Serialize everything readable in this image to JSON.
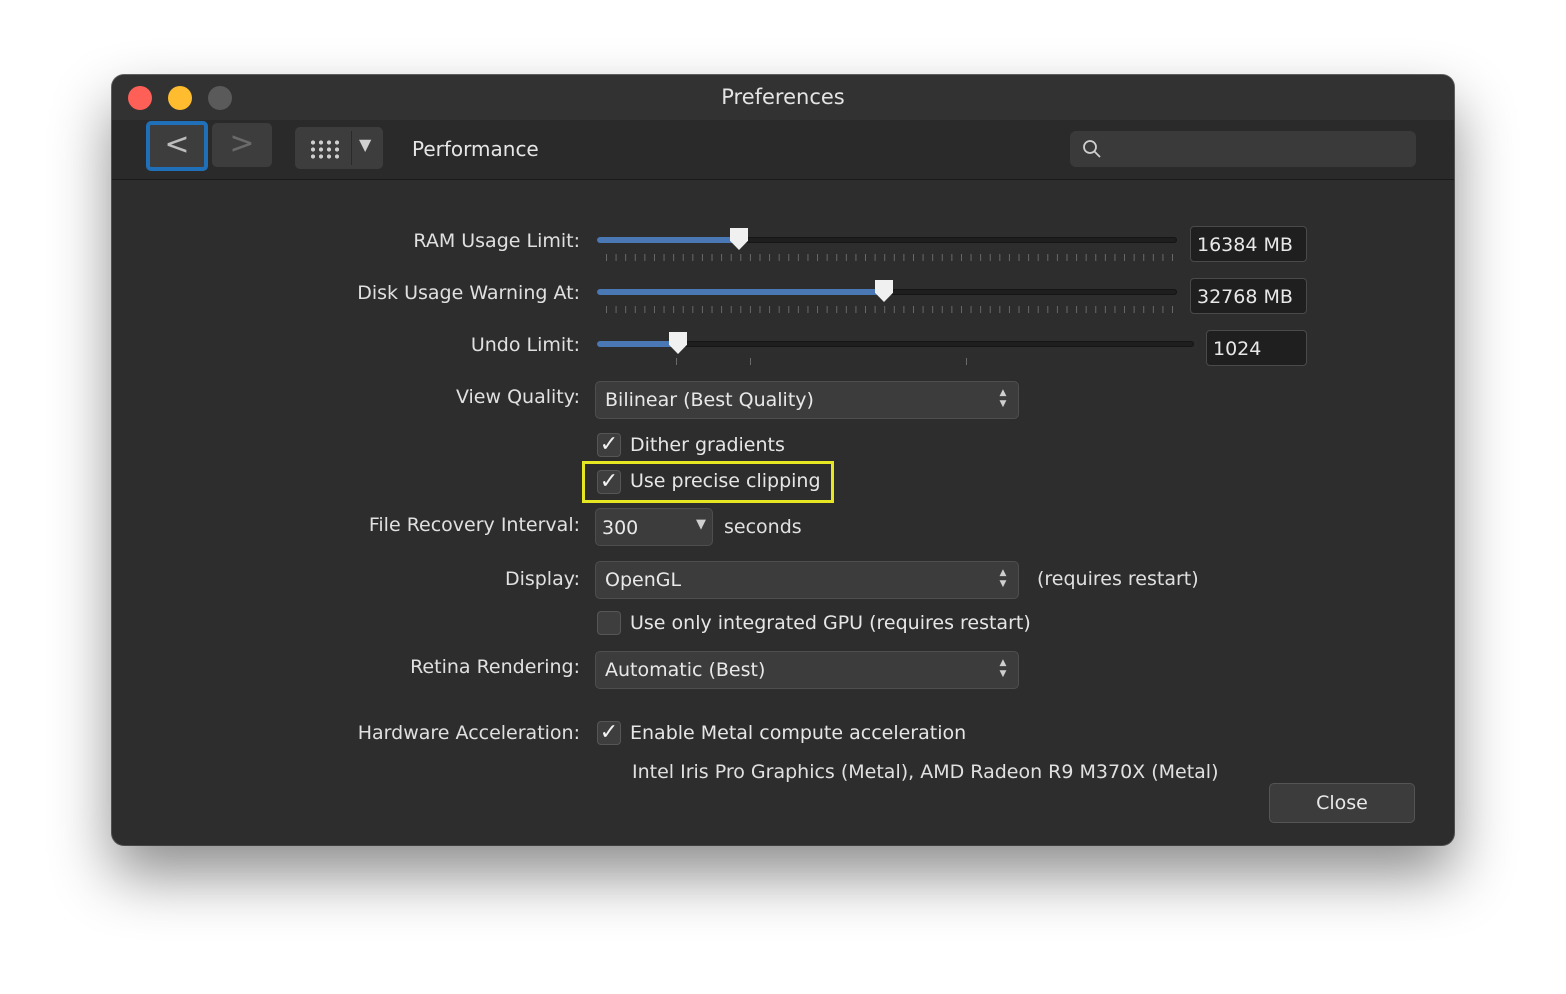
{
  "window": {
    "title": "Preferences"
  },
  "toolbar": {
    "back_symbol": "<",
    "forward_symbol": ">",
    "grid_menu_arrow": "▼",
    "section_title": "Performance",
    "search_placeholder": ""
  },
  "ram": {
    "label": "RAM Usage Limit:",
    "value": "16384 MB",
    "fraction": 0.245
  },
  "disk": {
    "label": "Disk Usage Warning At:",
    "value": "32768 MB",
    "fraction": 0.495
  },
  "undo": {
    "label": "Undo Limit:",
    "value": "1024",
    "fraction": 0.135
  },
  "view_quality": {
    "label": "View Quality:",
    "selected": "Bilinear (Best Quality)"
  },
  "dither": {
    "label": "Dither gradients",
    "checked": true
  },
  "precise_clipping": {
    "label": "Use precise clipping",
    "checked": true
  },
  "file_recovery": {
    "label": "File Recovery Interval:",
    "value": "300",
    "unit": "seconds"
  },
  "display": {
    "label": "Display:",
    "selected": "OpenGL",
    "note": "(requires restart)"
  },
  "integrated_gpu": {
    "label": "Use only integrated GPU (requires restart)",
    "checked": false
  },
  "retina": {
    "label": "Retina Rendering:",
    "selected": "Automatic (Best)"
  },
  "hardware": {
    "label": "Hardware Acceleration:",
    "metal_label": "Enable Metal compute acceleration",
    "metal_checked": true,
    "gpu_info": "Intel Iris Pro Graphics (Metal), AMD Radeon R9 M370X (Metal)"
  },
  "close_label": "Close",
  "colors": {
    "accent": "#4a78b5",
    "highlight": "#e7e623",
    "focus_ring": "#1f70b8"
  },
  "icons": {
    "check": "✓",
    "updown": "▲▼",
    "dropdown": "▼"
  }
}
